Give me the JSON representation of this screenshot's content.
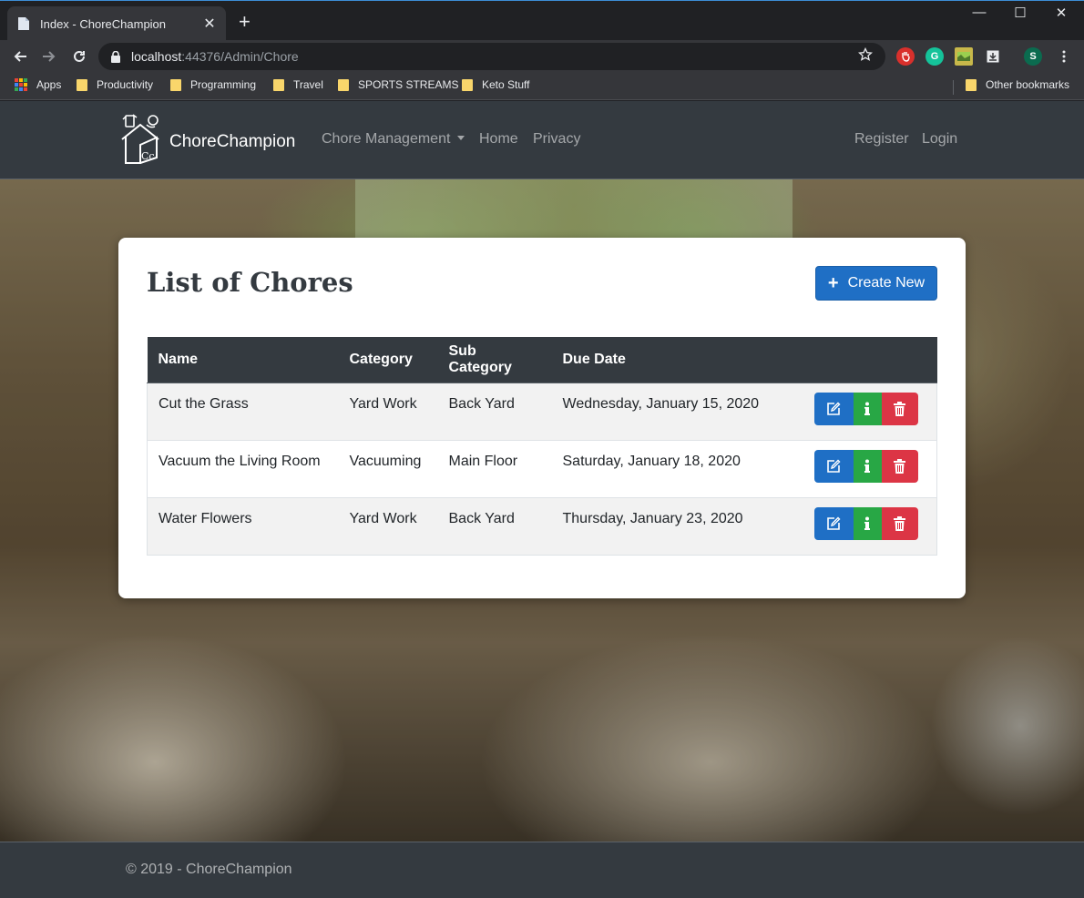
{
  "browser": {
    "tab_title": "Index - ChoreChampion",
    "close_tab": "✕",
    "new_tab": "+",
    "url_host": "localhost",
    "url_path": ":44376/Admin/Chore",
    "profile_initial": "S",
    "window_controls": {
      "minimize": "—",
      "maximize": "☐",
      "close": "✕"
    }
  },
  "bookmarks": {
    "apps": "Apps",
    "items": [
      "Productivity",
      "Programming",
      "Travel",
      "SPORTS STREAMS",
      "Keto Stuff"
    ],
    "other": "Other bookmarks"
  },
  "navbar": {
    "brand": "ChoreChampion",
    "links": {
      "chore_management": "Chore Management",
      "home": "Home",
      "privacy": "Privacy",
      "register": "Register",
      "login": "Login"
    }
  },
  "page": {
    "title": "List of Chores",
    "create_button": "Create New",
    "table": {
      "headers": [
        "Name",
        "Category",
        "Sub Category",
        "Due Date"
      ],
      "rows": [
        {
          "name": "Cut the Grass",
          "category": "Yard Work",
          "sub_category": "Back Yard",
          "due_date": "Wednesday, January 15, 2020"
        },
        {
          "name": "Vacuum the Living Room",
          "category": "Vacuuming",
          "sub_category": "Main Floor",
          "due_date": "Saturday, January 18, 2020"
        },
        {
          "name": "Water Flowers",
          "category": "Yard Work",
          "sub_category": "Back Yard",
          "due_date": "Thursday, January 23, 2020"
        }
      ]
    }
  },
  "footer": {
    "text": "© 2019 - ChoreChampion"
  },
  "colors": {
    "primary": "#1f6fc5",
    "success": "#28a745",
    "danger": "#dc3545",
    "navbar": "#343a40"
  }
}
